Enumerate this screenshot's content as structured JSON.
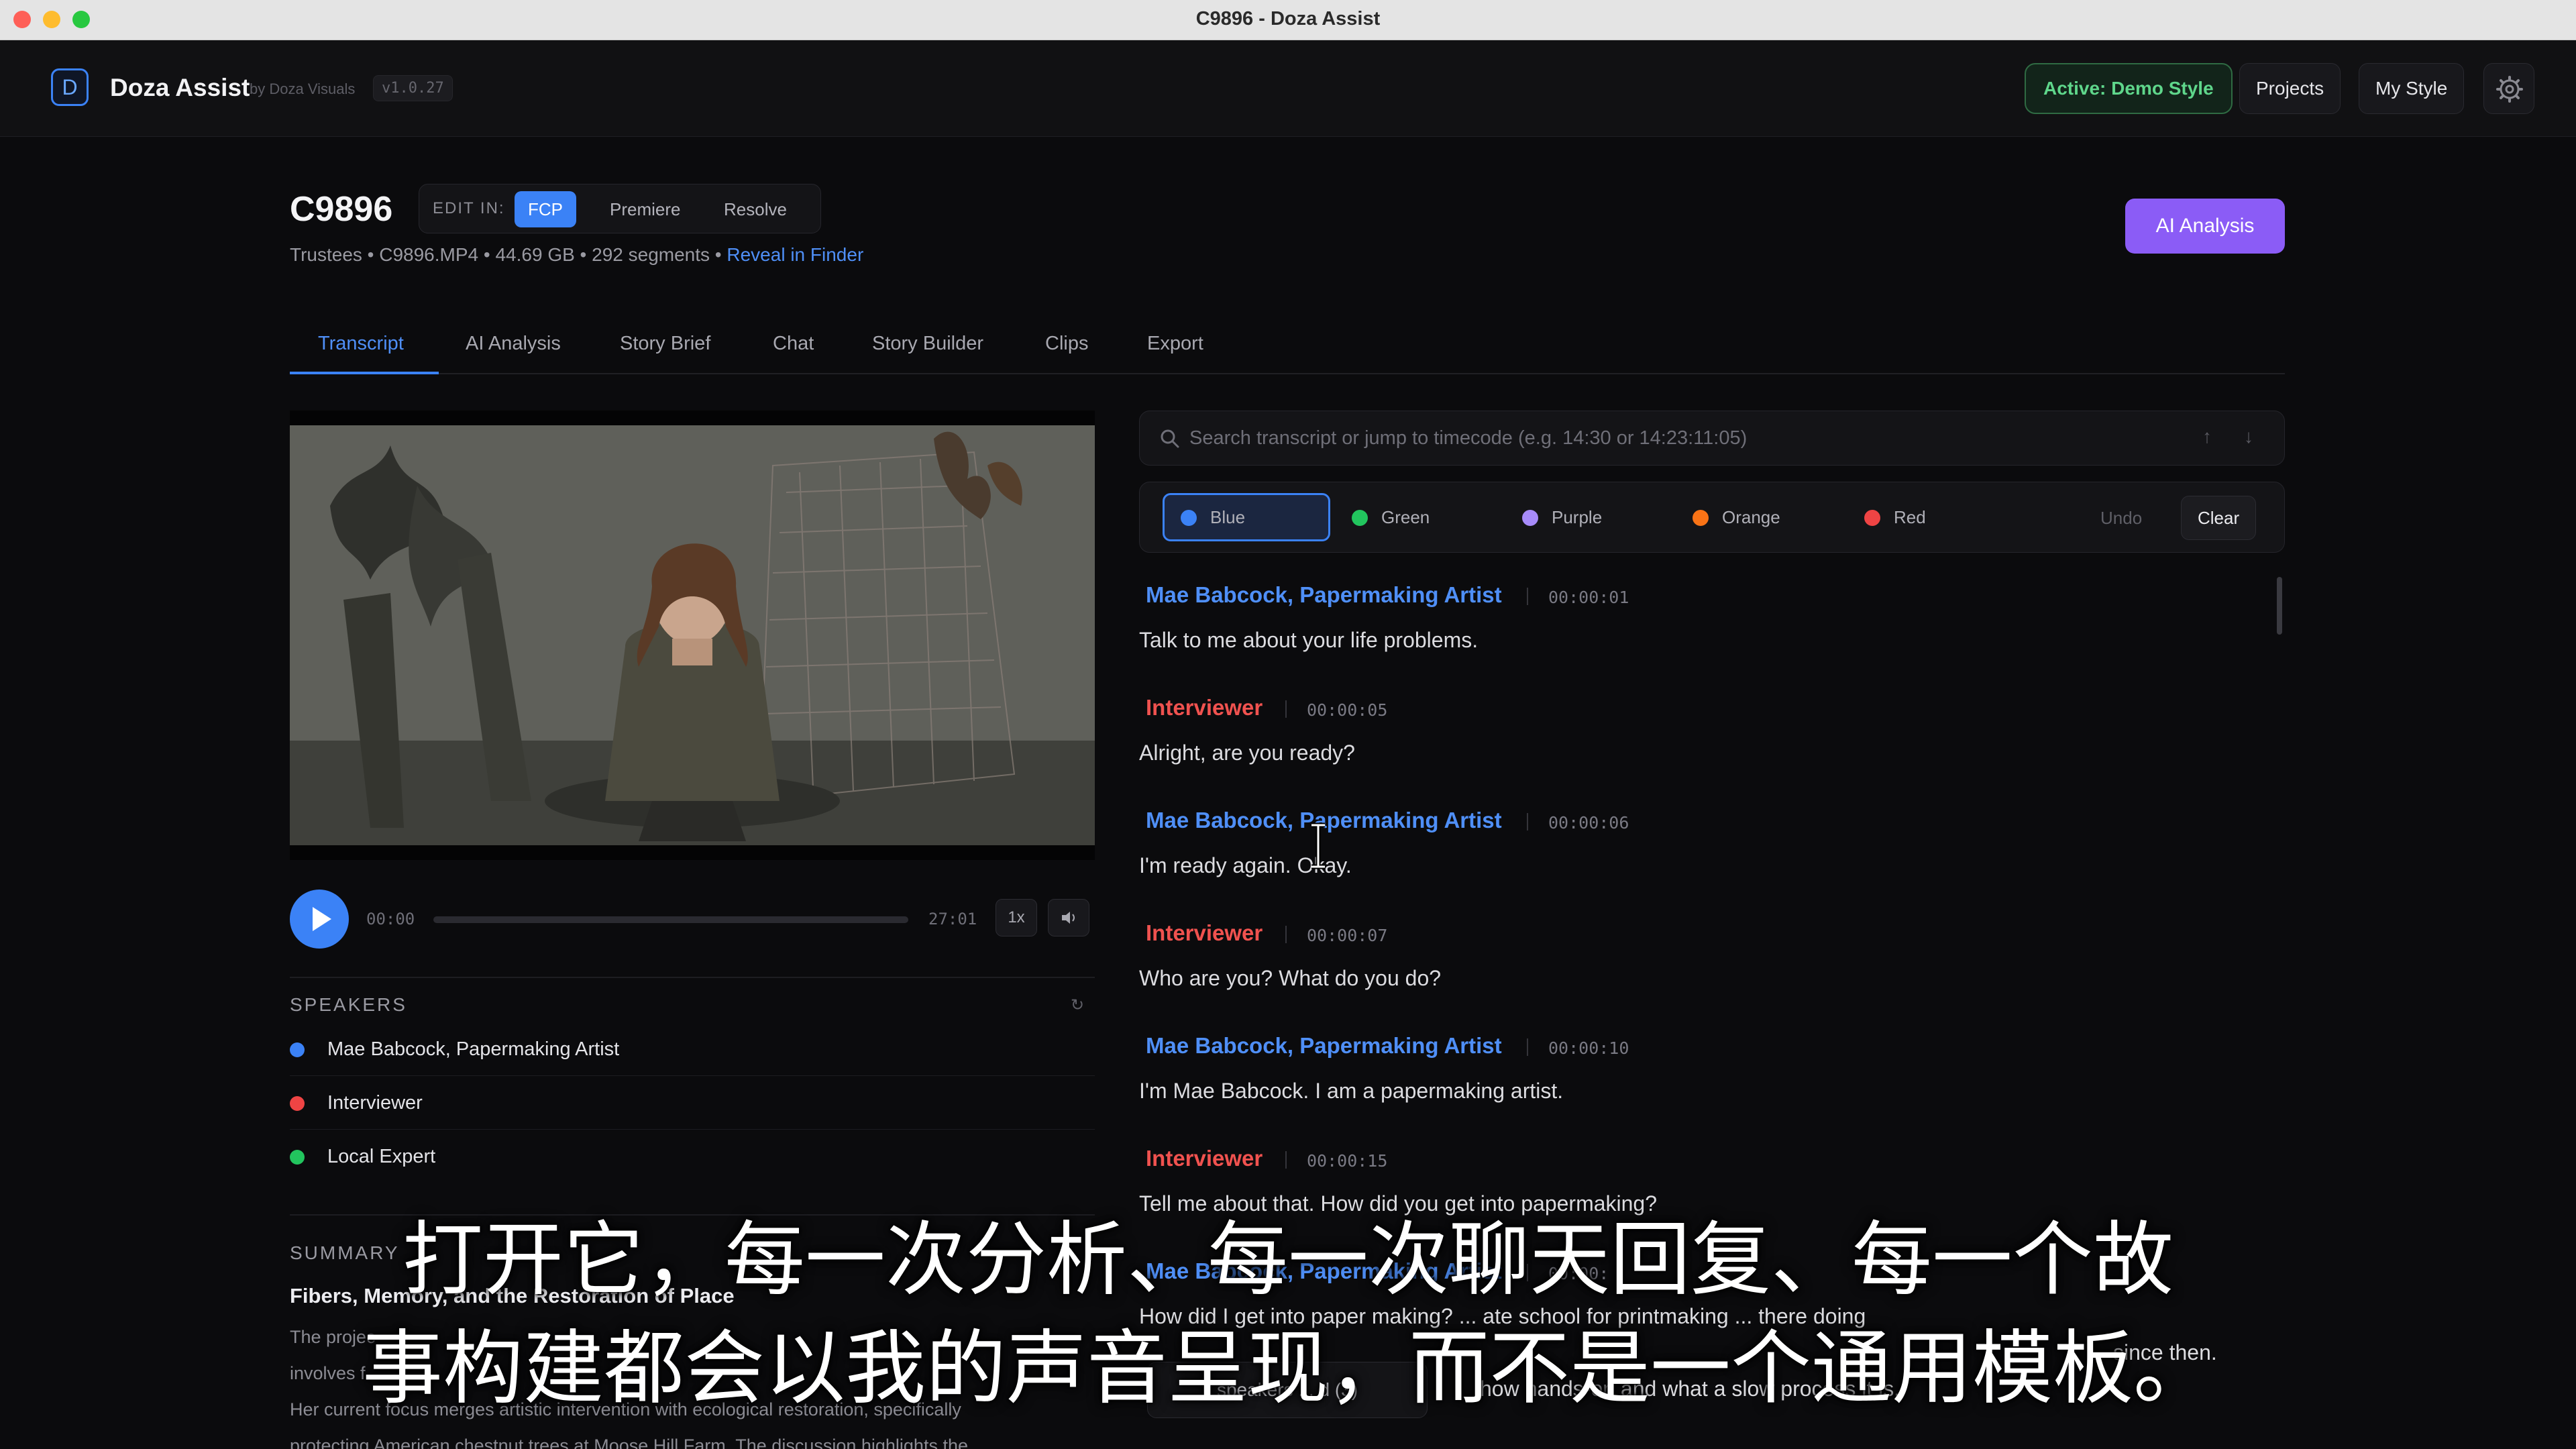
{
  "window": {
    "title": "C9896 - Doza Assist"
  },
  "app": {
    "logo_letter": "D",
    "name": "Doza Assist",
    "by": "by Doza Visuals",
    "version": "v1.0.27"
  },
  "header": {
    "active_style": "Active: Demo Style",
    "projects": "Projects",
    "my_style": "My Style",
    "settings_icon": "gear-icon"
  },
  "project": {
    "title": "C9896",
    "edit_in_label": "EDIT IN:",
    "edit_options": [
      "FCP",
      "Premiere",
      "Resolve"
    ],
    "edit_selected": "FCP",
    "meta": "Trustees • C9896.MP4 • 44.69 GB • 292 segments • ",
    "reveal": "Reveal in Finder",
    "ai_button": "AI Analysis"
  },
  "tabs": [
    {
      "label": "Transcript",
      "active": true
    },
    {
      "label": "AI Analysis",
      "active": false
    },
    {
      "label": "Story Brief",
      "active": false
    },
    {
      "label": "Chat",
      "active": false
    },
    {
      "label": "Story Builder",
      "active": false
    },
    {
      "label": "Clips",
      "active": false
    },
    {
      "label": "Export",
      "active": false
    }
  ],
  "player": {
    "current": "00:00",
    "duration": "27:01",
    "speed": "1x",
    "progress": 0
  },
  "speakers": {
    "title": "SPEAKERS",
    "items": [
      {
        "name": "Mae Babcock, Papermaking Artist",
        "color": "#3b82f6"
      },
      {
        "name": "Interviewer",
        "color": "#ef4444"
      },
      {
        "name": "Local Expert",
        "color": "#22c55e"
      }
    ]
  },
  "summary": {
    "title": "SUMMARY",
    "heading": "Fibers, Memory, and the Restoration of Place",
    "lines": [
      "The projec",
      "involves f",
      "Her current focus merges artistic intervention with ecological restoration, specifically",
      "protecting American chestnut trees at Moose Hill Farm. The discussion highlights the"
    ]
  },
  "search": {
    "placeholder": "Search transcript or jump to timecode (e.g. 14:30 or 14:23:11:05)",
    "up": "↑",
    "down": "↓"
  },
  "highlight": {
    "colors": [
      {
        "label": "Blue",
        "color": "#3b82f6",
        "selected": true
      },
      {
        "label": "Green",
        "color": "#22c55e",
        "selected": false
      },
      {
        "label": "Purple",
        "color": "#a78bfa",
        "selected": false
      },
      {
        "label": "Orange",
        "color": "#f97316",
        "selected": false
      },
      {
        "label": "Red",
        "color": "#ef4444",
        "selected": false
      }
    ],
    "undo": "Undo",
    "clear": "Clear"
  },
  "transcript": [
    {
      "speaker": "Mae Babcock, Papermaking Artist",
      "color": "#4f8ff7",
      "time": "00:00:01",
      "text": "Talk to me about your life problems."
    },
    {
      "speaker": "Interviewer",
      "color": "#f0524f",
      "time": "00:00:05",
      "text": "Alright, are you ready?"
    },
    {
      "speaker": "Mae Babcock, Papermaking Artist",
      "color": "#4f8ff7",
      "time": "00:00:06",
      "text": "I'm ready again. Okay."
    },
    {
      "speaker": "Interviewer",
      "color": "#f0524f",
      "time": "00:00:07",
      "text": "Who are you? What do you do?"
    },
    {
      "speaker": "Mae Babcock, Papermaking Artist",
      "color": "#4f8ff7",
      "time": "00:00:10",
      "text": "I'm Mae Babcock. I am a papermaking artist."
    },
    {
      "speaker": "Interviewer",
      "color": "#f0524f",
      "time": "00:00:15",
      "text": "Tell me about that. How did you get into papermaking?"
    },
    {
      "speaker": "Mae Babcock, Papermaking Artist",
      "color": "#4f8ff7",
      "time": "00:00:",
      "text": "How did I get into paper making? ... ate school for printmaking ... there doing"
    }
  ],
  "transcript_tail": [
    "since then.",
    "how hands-on and what a slow process it is."
  ],
  "bubble": "speakers ... d (3)",
  "subtitles": [
    "打开它，每一次分析、每一次聊天回复、每一个故",
    "事构建都会以我的声音呈现，而不是一个通用模板。"
  ]
}
